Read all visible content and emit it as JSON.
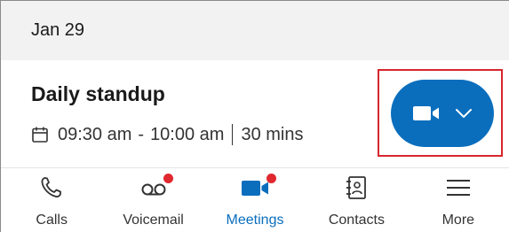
{
  "date_header": {
    "label": "Jan 29"
  },
  "meeting": {
    "title": "Daily standup",
    "start": "09:30 am",
    "dash": "-",
    "end": "10:00 am",
    "duration": "30 mins",
    "join_icon": "video-camera-icon",
    "dropdown_icon": "chevron-down-icon"
  },
  "tabs": [
    {
      "label": "Calls",
      "icon": "phone-icon",
      "active": false,
      "badge": false
    },
    {
      "label": "Voicemail",
      "icon": "voicemail-icon",
      "active": false,
      "badge": true
    },
    {
      "label": "Meetings",
      "icon": "video-camera-icon",
      "active": true,
      "badge": true
    },
    {
      "label": "Contacts",
      "icon": "contacts-book-icon",
      "active": false,
      "badge": false
    },
    {
      "label": "More",
      "icon": "menu-icon",
      "active": false,
      "badge": false
    }
  ],
  "colors": {
    "accent": "#0a6ebd",
    "badge": "#e0282f",
    "highlight_outline": "#d7262e",
    "header_bg": "#f2f2f2"
  }
}
